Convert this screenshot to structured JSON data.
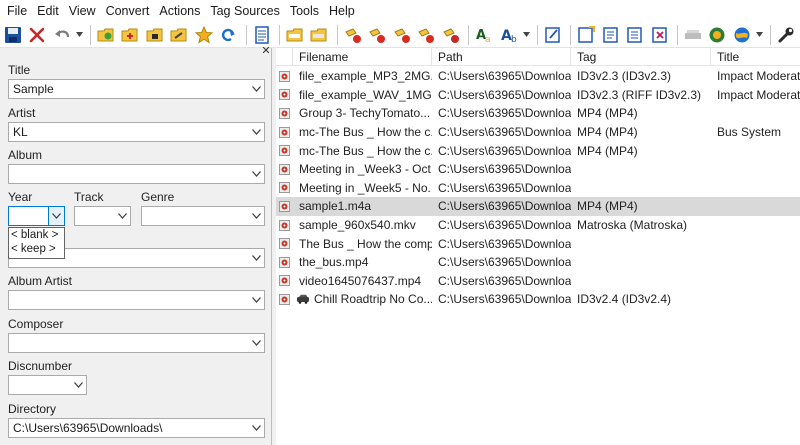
{
  "menu": [
    "File",
    "Edit",
    "View",
    "Convert",
    "Actions",
    "Tag Sources",
    "Tools",
    "Help"
  ],
  "toolbar": {
    "icons": [
      "save-icon",
      "remove-tag-icon",
      "undo-icon",
      "open-directory-icon",
      "add-directory-icon",
      "save-playlist-icon",
      "favorites-icon",
      "refresh-icon",
      "text-file-icon",
      "tag-to-filename-icon",
      "filename-to-tag-icon",
      "tag-sources-icon",
      "case-conversion-icon",
      "export-icon",
      "web-sources-icon",
      "tools-icon"
    ]
  },
  "tag_panel": {
    "title_label": "Title",
    "title_value": "Sample",
    "artist_label": "Artist",
    "artist_value": "KL",
    "album_label": "Album",
    "album_value": "",
    "year_label": "Year",
    "year_value": "",
    "track_label": "Track",
    "track_value": "",
    "genre_label": "Genre",
    "genre_value": "",
    "comment_value": "",
    "album_artist_label": "Album Artist",
    "album_artist_value": "",
    "composer_label": "Composer",
    "composer_value": "",
    "discnumber_label": "Discnumber",
    "discnumber_value": "",
    "directory_label": "Directory",
    "directory_value": "C:\\Users\\63965\\Downloads\\",
    "year_dropdown_options": [
      "< blank >",
      "< keep >"
    ]
  },
  "file_list": {
    "columns": [
      "Filename",
      "Path",
      "Tag",
      "Title"
    ],
    "rows": [
      {
        "filename": "file_example_MP3_2MG...",
        "path": "C:\\Users\\63965\\Downloa...",
        "tag": "ID3v2.3 (ID3v2.3)",
        "title": "Impact Moderato"
      },
      {
        "filename": "file_example_WAV_1MG...",
        "path": "C:\\Users\\63965\\Downloa...",
        "tag": "ID3v2.3 (RIFF ID3v2.3)",
        "title": "Impact Moderato"
      },
      {
        "filename": "Group 3- TechyTomato...",
        "path": "C:\\Users\\63965\\Downloa...",
        "tag": "MP4 (MP4)",
        "title": ""
      },
      {
        "filename": "mc-The Bus _ How the c...",
        "path": "C:\\Users\\63965\\Downloa...",
        "tag": "MP4 (MP4)",
        "title": "Bus System"
      },
      {
        "filename": "mc-The Bus _ How the c...",
        "path": "C:\\Users\\63965\\Downloa...",
        "tag": "MP4 (MP4)",
        "title": ""
      },
      {
        "filename": "Meeting in _Week3 - Oct...",
        "path": "C:\\Users\\63965\\Downloa...",
        "tag": "",
        "title": ""
      },
      {
        "filename": "Meeting in _Week5 - No...",
        "path": "C:\\Users\\63965\\Downloa...",
        "tag": "",
        "title": ""
      },
      {
        "filename": "sample1.m4a",
        "path": "C:\\Users\\63965\\Downloa...",
        "tag": "MP4 (MP4)",
        "title": "",
        "selected": true
      },
      {
        "filename": "sample_960x540.mkv",
        "path": "C:\\Users\\63965\\Downloa...",
        "tag": "Matroska (Matroska)",
        "title": ""
      },
      {
        "filename": "The Bus _ How the comp...",
        "path": "C:\\Users\\63965\\Downloa...",
        "tag": "",
        "title": ""
      },
      {
        "filename": "the_bus.mp4",
        "path": "C:\\Users\\63965\\Downloa...",
        "tag": "",
        "title": ""
      },
      {
        "filename": "video1645076437.mp4",
        "path": "C:\\Users\\63965\\Downloa...",
        "tag": "",
        "title": ""
      },
      {
        "filename": "Chill Roadtrip No Co...",
        "path": "C:\\Users\\63965\\Downloa...",
        "tag": "ID3v2.4 (ID3v2.4)",
        "title": "",
        "has_cover": true
      }
    ]
  },
  "colors": {
    "accent": "#0078d7",
    "selected_row": "#d9d9d9",
    "panel_bg": "#f0f0f0",
    "file_icon": "#c0392b"
  }
}
